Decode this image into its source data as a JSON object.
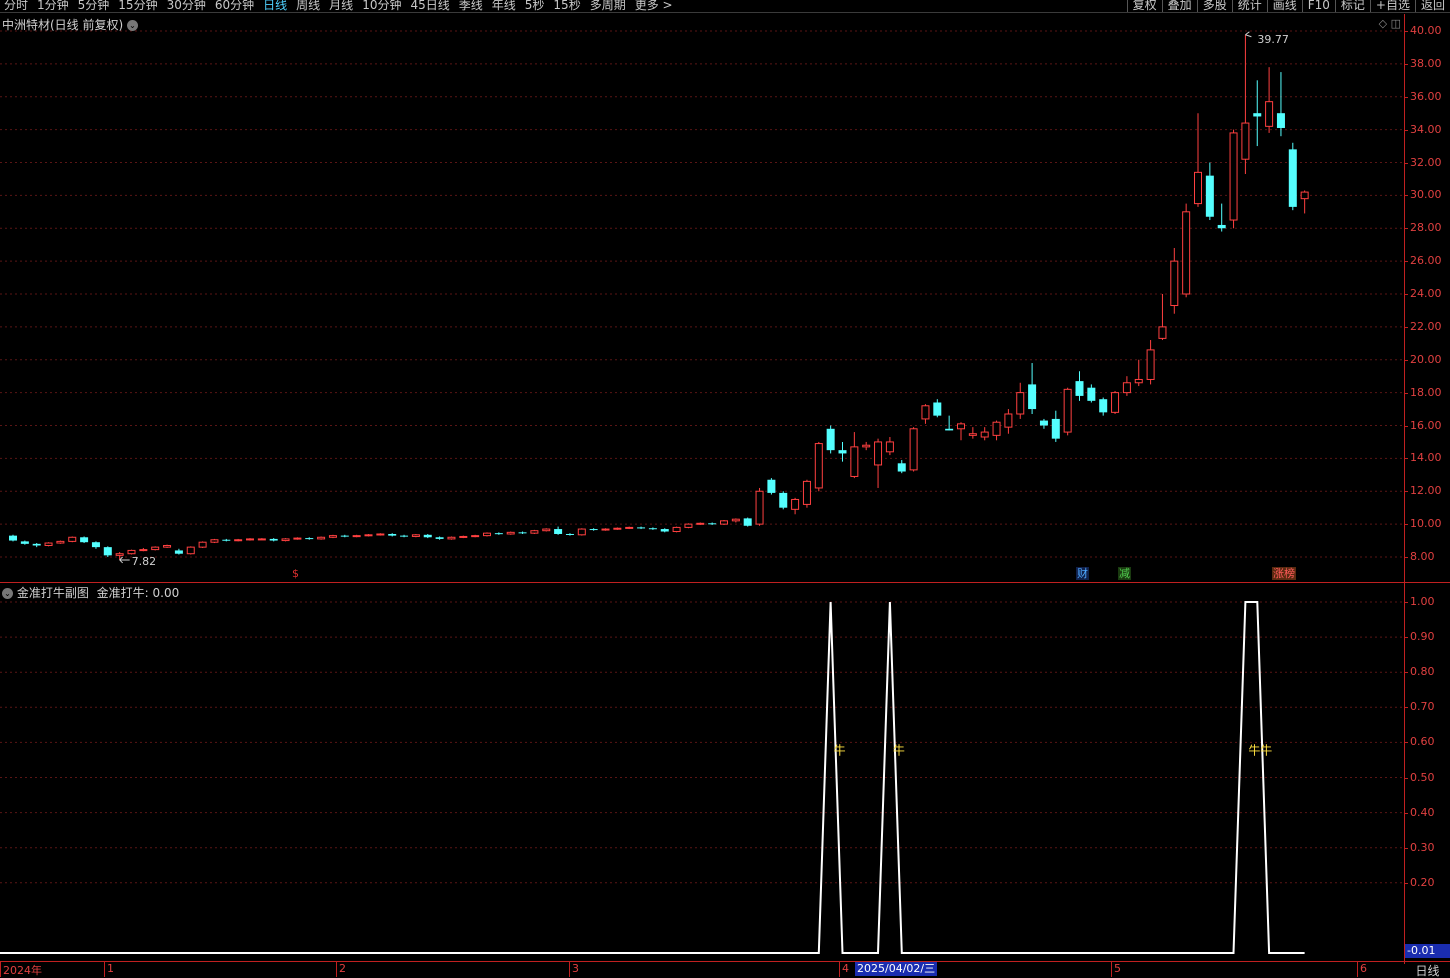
{
  "toolbar": {
    "periods": [
      "分时",
      "1分钟",
      "5分钟",
      "15分钟",
      "30分钟",
      "60分钟",
      "日线",
      "周线",
      "月线",
      "10分钟",
      "45日线",
      "季线",
      "年线",
      "5秒",
      "15秒",
      "多周期",
      "更多 >"
    ],
    "active_period": "日线",
    "tools": [
      "复权",
      "叠加",
      "多股",
      "统计",
      "画线",
      "F10",
      "标记",
      "+自选",
      "返回"
    ]
  },
  "main_pane": {
    "title": "中洲特材(日线 前复权)",
    "high_label": "39.77",
    "low_label": "7.82",
    "badges": [
      {
        "text": "$",
        "color": "#e03030"
      },
      {
        "text": "财",
        "color": "#4fa8ff"
      },
      {
        "text": "减",
        "color": "#50d050"
      },
      {
        "text": "涨榜",
        "color": "#ff5a5a"
      }
    ],
    "y_ticks": [
      "40.00",
      "38.00",
      "36.00",
      "34.00",
      "32.00",
      "30.00",
      "28.00",
      "26.00",
      "24.00",
      "22.00",
      "20.00",
      "18.00",
      "16.00",
      "14.00",
      "12.00",
      "10.00",
      "8.00"
    ]
  },
  "sub_pane": {
    "title": "金准打牛副图",
    "value_label": "金准打牛: 0.00",
    "marker_glyph": "牛",
    "y_ticks": [
      "1.00",
      "0.90",
      "0.80",
      "0.70",
      "0.60",
      "0.50",
      "0.40",
      "0.30",
      "0.20"
    ],
    "current_value": "-0.01"
  },
  "date_axis": {
    "labels": [
      "2024年",
      "1",
      "2",
      "3",
      "4",
      "5",
      "6"
    ],
    "cursor_date": "2025/04/02/三",
    "corner_label": "日线"
  },
  "chart_data": {
    "type": "candlestick",
    "y_range": [
      7.0,
      40.5
    ],
    "candles": [
      [
        9.3,
        9.0,
        9.35,
        8.95
      ],
      [
        8.95,
        8.8,
        9.0,
        8.75
      ],
      [
        8.8,
        8.7,
        8.85,
        8.6
      ],
      [
        8.7,
        8.85,
        8.9,
        8.65
      ],
      [
        8.85,
        8.95,
        9.0,
        8.8
      ],
      [
        8.95,
        9.2,
        9.25,
        8.9
      ],
      [
        9.2,
        8.9,
        9.25,
        8.85
      ],
      [
        8.9,
        8.6,
        8.95,
        8.5
      ],
      [
        8.6,
        8.1,
        8.65,
        8.0
      ],
      [
        8.1,
        8.2,
        8.3,
        7.82
      ],
      [
        8.2,
        8.4,
        8.45,
        8.15
      ],
      [
        8.4,
        8.45,
        8.55,
        8.35
      ],
      [
        8.45,
        8.6,
        8.65,
        8.4
      ],
      [
        8.6,
        8.7,
        8.75,
        8.55
      ],
      [
        8.4,
        8.2,
        8.5,
        8.15
      ],
      [
        8.2,
        8.6,
        8.65,
        8.15
      ],
      [
        8.6,
        8.9,
        8.95,
        8.55
      ],
      [
        8.9,
        9.05,
        9.1,
        8.85
      ],
      [
        9.05,
        9.0,
        9.1,
        8.95
      ],
      [
        9.0,
        9.05,
        9.1,
        8.95
      ],
      [
        9.05,
        9.1,
        9.15,
        9.0
      ],
      [
        9.1,
        9.1,
        9.15,
        9.05
      ],
      [
        9.1,
        9.0,
        9.15,
        8.95
      ],
      [
        9.0,
        9.1,
        9.15,
        8.95
      ],
      [
        9.1,
        9.15,
        9.2,
        9.05
      ],
      [
        9.15,
        9.1,
        9.2,
        9.05
      ],
      [
        9.1,
        9.2,
        9.25,
        9.05
      ],
      [
        9.2,
        9.3,
        9.35,
        9.15
      ],
      [
        9.3,
        9.25,
        9.35,
        9.2
      ],
      [
        9.25,
        9.3,
        9.35,
        9.2
      ],
      [
        9.3,
        9.35,
        9.4,
        9.25
      ],
      [
        9.35,
        9.4,
        9.45,
        9.3
      ],
      [
        9.4,
        9.3,
        9.45,
        9.25
      ],
      [
        9.3,
        9.25,
        9.35,
        9.2
      ],
      [
        9.25,
        9.35,
        9.4,
        9.2
      ],
      [
        9.35,
        9.2,
        9.4,
        9.15
      ],
      [
        9.2,
        9.1,
        9.25,
        9.05
      ],
      [
        9.1,
        9.2,
        9.25,
        9.05
      ],
      [
        9.2,
        9.25,
        9.3,
        9.15
      ],
      [
        9.25,
        9.3,
        9.35,
        9.2
      ],
      [
        9.3,
        9.45,
        9.5,
        9.25
      ],
      [
        9.45,
        9.4,
        9.5,
        9.35
      ],
      [
        9.4,
        9.5,
        9.55,
        9.35
      ],
      [
        9.5,
        9.45,
        9.55,
        9.4
      ],
      [
        9.45,
        9.6,
        9.65,
        9.4
      ],
      [
        9.6,
        9.7,
        9.75,
        9.55
      ],
      [
        9.7,
        9.4,
        9.85,
        9.35
      ],
      [
        9.4,
        9.35,
        9.45,
        9.3
      ],
      [
        9.35,
        9.7,
        9.75,
        9.3
      ],
      [
        9.7,
        9.65,
        9.75,
        9.6
      ],
      [
        9.65,
        9.7,
        9.75,
        9.6
      ],
      [
        9.7,
        9.75,
        9.8,
        9.65
      ],
      [
        9.75,
        9.8,
        9.85,
        9.7
      ],
      [
        9.8,
        9.75,
        9.85,
        9.7
      ],
      [
        9.75,
        9.7,
        9.8,
        9.65
      ],
      [
        9.7,
        9.55,
        9.75,
        9.5
      ],
      [
        9.55,
        9.8,
        9.85,
        9.5
      ],
      [
        9.8,
        10.0,
        10.05,
        9.75
      ],
      [
        10.0,
        10.05,
        10.1,
        9.95
      ],
      [
        10.05,
        10.0,
        10.1,
        9.95
      ],
      [
        10.0,
        10.2,
        10.25,
        9.95
      ],
      [
        10.2,
        10.3,
        10.35,
        10.1
      ],
      [
        10.35,
        9.9,
        10.4,
        9.85
      ],
      [
        10.0,
        12.0,
        12.2,
        9.9
      ],
      [
        12.7,
        11.9,
        12.8,
        11.8
      ],
      [
        11.9,
        11.0,
        12.0,
        10.9
      ],
      [
        10.9,
        11.5,
        11.6,
        10.6
      ],
      [
        11.2,
        12.6,
        12.7,
        11.0
      ],
      [
        12.2,
        14.9,
        15.0,
        12.0
      ],
      [
        15.8,
        14.5,
        16.0,
        14.3
      ],
      [
        14.5,
        14.3,
        15.0,
        13.8
      ],
      [
        12.9,
        14.7,
        15.6,
        12.8
      ],
      [
        14.7,
        14.8,
        15.0,
        14.5
      ],
      [
        13.6,
        15.0,
        15.2,
        12.2
      ],
      [
        14.4,
        15.0,
        15.3,
        14.2
      ],
      [
        13.7,
        13.2,
        13.9,
        13.1
      ],
      [
        13.3,
        15.8,
        15.9,
        13.2
      ],
      [
        16.4,
        17.2,
        17.3,
        16.1
      ],
      [
        17.4,
        16.6,
        17.6,
        16.5
      ],
      [
        15.8,
        15.7,
        16.6,
        15.7
      ],
      [
        15.8,
        16.1,
        16.2,
        15.1
      ],
      [
        15.4,
        15.5,
        15.9,
        15.2
      ],
      [
        15.3,
        15.6,
        15.9,
        15.1
      ],
      [
        15.4,
        16.2,
        16.3,
        15.1
      ],
      [
        15.9,
        16.7,
        17.0,
        15.5
      ],
      [
        16.7,
        18.0,
        18.6,
        16.4
      ],
      [
        18.5,
        17.0,
        19.8,
        16.7
      ],
      [
        16.3,
        16.0,
        16.4,
        15.8
      ],
      [
        16.4,
        15.2,
        16.9,
        15.0
      ],
      [
        15.6,
        18.2,
        18.3,
        15.4
      ],
      [
        18.7,
        17.8,
        19.3,
        17.5
      ],
      [
        18.3,
        17.5,
        18.5,
        17.4
      ],
      [
        17.6,
        16.8,
        17.7,
        16.6
      ],
      [
        16.8,
        18.0,
        18.1,
        16.7
      ],
      [
        18.0,
        18.6,
        19.0,
        17.8
      ],
      [
        18.6,
        18.8,
        20.0,
        18.4
      ],
      [
        18.8,
        20.6,
        21.2,
        18.5
      ],
      [
        21.3,
        22.0,
        24.0,
        21.2
      ],
      [
        23.3,
        26.0,
        26.8,
        22.8
      ],
      [
        24.0,
        29.0,
        29.5,
        23.8
      ],
      [
        29.5,
        31.4,
        35.0,
        29.3
      ],
      [
        31.2,
        28.7,
        32.0,
        28.5
      ],
      [
        28.2,
        28.0,
        29.5,
        27.8
      ],
      [
        28.5,
        33.8,
        34.0,
        28.0
      ],
      [
        32.2,
        34.4,
        39.77,
        31.3
      ],
      [
        35.0,
        34.8,
        37.0,
        33.0
      ],
      [
        34.2,
        35.7,
        37.8,
        33.8
      ],
      [
        35.0,
        34.1,
        37.5,
        33.6
      ],
      [
        32.8,
        29.3,
        33.2,
        29.1
      ],
      [
        29.8,
        30.2,
        30.3,
        28.9
      ]
    ],
    "indicator": {
      "name": "金准打牛",
      "range": [
        -0.01,
        1.05
      ],
      "values": [
        0,
        0,
        0,
        0,
        0,
        0,
        0,
        0,
        0,
        0,
        0,
        0,
        0,
        0,
        0,
        0,
        0,
        0,
        0,
        0,
        0,
        0,
        0,
        0,
        0,
        0,
        0,
        0,
        0,
        0,
        0,
        0,
        0,
        0,
        0,
        0,
        0,
        0,
        0,
        0,
        0,
        0,
        0,
        0,
        0,
        0,
        0,
        0,
        0,
        0,
        0,
        0,
        0,
        0,
        0,
        0,
        0,
        0,
        0,
        0,
        0,
        0,
        0,
        0,
        0,
        0,
        0,
        0,
        0,
        1,
        0,
        0,
        0,
        0,
        1,
        0,
        0,
        0,
        0,
        0,
        0,
        0,
        0,
        0,
        0,
        0,
        0,
        0,
        0,
        0,
        0,
        0,
        0,
        0,
        0,
        0,
        0,
        0,
        0,
        0,
        0,
        0,
        0,
        0,
        1,
        1,
        0,
        0,
        0,
        0
      ],
      "markers": [
        69,
        74,
        104,
        105
      ]
    }
  }
}
